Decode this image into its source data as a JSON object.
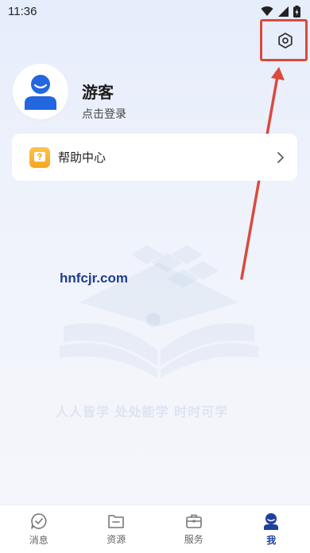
{
  "status_bar": {
    "time": "11:36"
  },
  "profile": {
    "name": "游客",
    "login": "点击登录"
  },
  "menu": {
    "help_center": "帮助中心"
  },
  "watermark": {
    "url": "hnfcjr.com",
    "slogan": "人人皆学  处处能学  时时可学"
  },
  "tabs": [
    {
      "label": "消息",
      "icon": "message-icon"
    },
    {
      "label": "资源",
      "icon": "folder-icon"
    },
    {
      "label": "服务",
      "icon": "briefcase-icon"
    },
    {
      "label": "我",
      "icon": "profile-icon"
    }
  ],
  "colors": {
    "accent": "#1e3f9c",
    "avatar_blue": "#2266e0",
    "highlight": "#d94a3d"
  }
}
